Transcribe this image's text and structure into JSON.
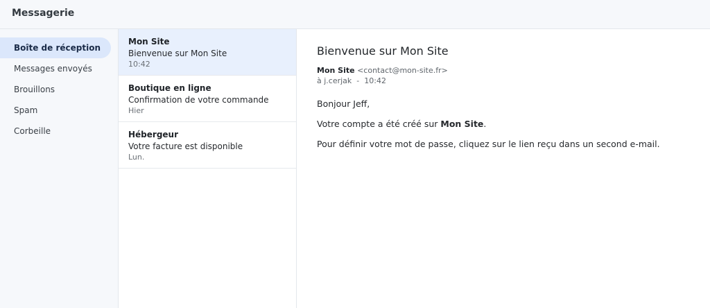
{
  "app": {
    "title": "Messagerie"
  },
  "sidebar": {
    "items": [
      {
        "label": "Boîte de réception",
        "active": true
      },
      {
        "label": "Messages envoyés",
        "active": false
      },
      {
        "label": "Brouillons",
        "active": false
      },
      {
        "label": "Spam",
        "active": false
      },
      {
        "label": "Corbeille",
        "active": false
      }
    ]
  },
  "messages": [
    {
      "sender": "Mon Site",
      "subject": "Bienvenue sur Mon Site",
      "time": "10:42",
      "selected": true
    },
    {
      "sender": "Boutique en ligne",
      "subject": "Confirmation de votre commande",
      "time": "Hier",
      "selected": false
    },
    {
      "sender": "Hébergeur",
      "subject": "Votre facture est disponible",
      "time": "Lun.",
      "selected": false
    }
  ],
  "reader": {
    "subject": "Bienvenue sur Mon Site",
    "from_name": "Mon Site",
    "from_email": "<contact@mon-site.fr>",
    "to": "à j.cerjak",
    "separator": "-",
    "time": "10:42",
    "body": {
      "greeting": "Bonjour Jeff,",
      "line2_prefix": "Votre compte a été créé sur ",
      "line2_bold": "Mon Site",
      "line2_suffix": ".",
      "line3": "Pour définir votre mot de passe, cliquez sur le lien reçu dans un second e-mail."
    }
  },
  "colors": {
    "accent_active": "#dbe7fb",
    "selected_row": "#e8f0fd",
    "sidebar_bg": "#f6f8fb"
  }
}
